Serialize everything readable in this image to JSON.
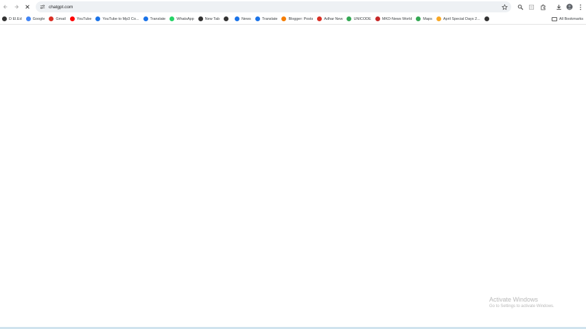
{
  "toolbar": {
    "url": "chatgpt.com"
  },
  "bookmarks": [
    {
      "label": "D El.Ed",
      "icon": "globe-icon",
      "color": "#333333"
    },
    {
      "label": "Google",
      "icon": "google-icon",
      "color": "#4285f4"
    },
    {
      "label": "Gmail",
      "icon": "gmail-icon",
      "color": "#d93025"
    },
    {
      "label": "YouTube",
      "icon": "youtube-icon",
      "color": "#ff0000"
    },
    {
      "label": "YouTube to Mp3 Co...",
      "icon": "converter-icon",
      "color": "#1a73e8"
    },
    {
      "label": "Translate",
      "icon": "translate-icon",
      "color": "#1a73e8"
    },
    {
      "label": "WhatsApp",
      "icon": "whatsapp-icon",
      "color": "#25d366"
    },
    {
      "label": "New Tab",
      "icon": "globe-icon",
      "color": "#333333"
    },
    {
      "label": "",
      "icon": "globe-icon",
      "color": "#333333"
    },
    {
      "label": "News",
      "icon": "news-icon",
      "color": "#1a73e8"
    },
    {
      "label": "Translate",
      "icon": "translate-icon",
      "color": "#1a73e8"
    },
    {
      "label": "Blogger: Posts",
      "icon": "blogger-icon",
      "color": "#f57d00"
    },
    {
      "label": "Adhar New",
      "icon": "aadhaar-icon",
      "color": "#d93025"
    },
    {
      "label": "UNICODE",
      "icon": "unicode-icon",
      "color": "#34a853"
    },
    {
      "label": "MKD-News World",
      "icon": "news-world-icon",
      "color": "#c62828"
    },
    {
      "label": "Maps",
      "icon": "map-pin-icon",
      "color": "#34a853"
    },
    {
      "label": "April Special Days 2...",
      "icon": "rainbow-icon",
      "color": "#f9a825"
    },
    {
      "label": "",
      "icon": "globe-icon",
      "color": "#333333"
    }
  ],
  "all_bookmarks_label": "All Bookmarks",
  "watermark": {
    "title": "Activate Windows",
    "subtitle": "Go to Settings to activate Windows."
  }
}
